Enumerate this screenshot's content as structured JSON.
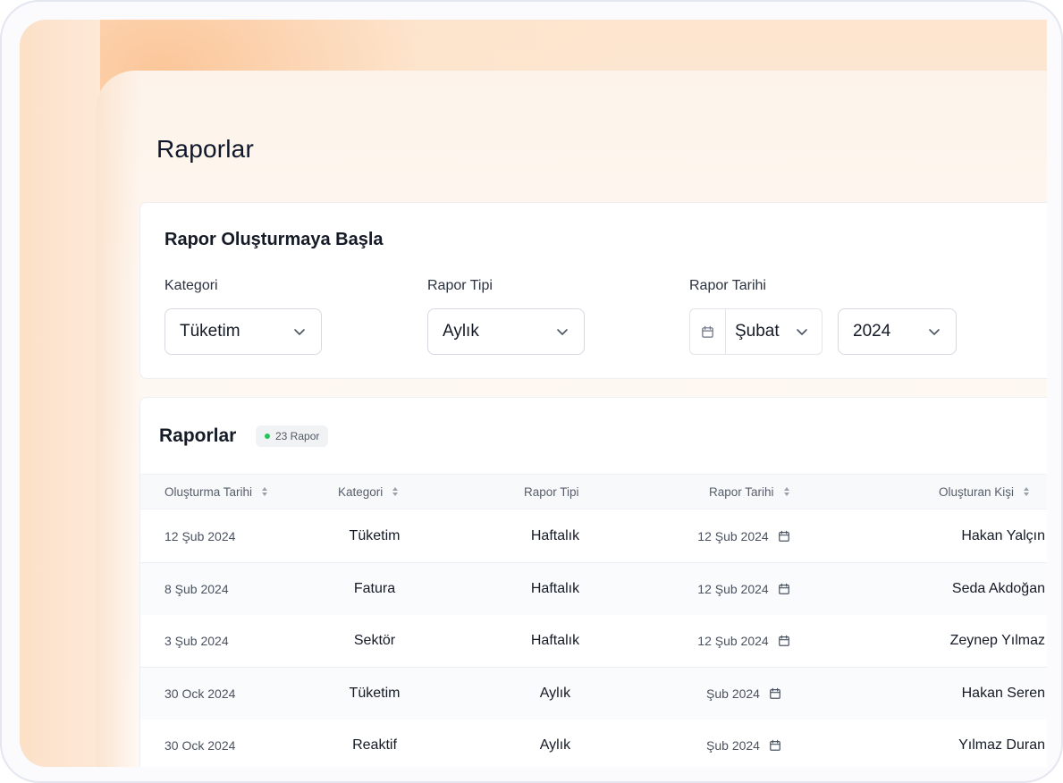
{
  "page": {
    "title": "Raporlar"
  },
  "filters": {
    "title": "Rapor Oluşturmaya Başla",
    "category": {
      "label": "Kategori",
      "value": "Tüketim"
    },
    "report_type": {
      "label": "Rapor Tipi",
      "value": "Aylık"
    },
    "report_date": {
      "label": "Rapor Tarihi",
      "month": "Şubat",
      "year": "2024"
    }
  },
  "table": {
    "title": "Raporlar",
    "badge": "23 Rapor",
    "columns": [
      "Oluşturma Tarihi",
      "Kategori",
      "Rapor Tipi",
      "Rapor Tarihi",
      "Oluşturan Kişi"
    ],
    "rows": [
      {
        "created": "12 Şub 2024",
        "category": "Tüketim",
        "type": "Haftalık",
        "report_date": "12 Şub 2024",
        "creator": "Hakan Yalçın"
      },
      {
        "created": "8 Şub 2024",
        "category": "Fatura",
        "type": "Haftalık",
        "report_date": "12 Şub 2024",
        "creator": "Seda Akdoğan"
      },
      {
        "created": "3 Şub 2024",
        "category": "Sektör",
        "type": "Haftalık",
        "report_date": "12 Şub 2024",
        "creator": "Zeynep Yılmaz"
      },
      {
        "created": "30 Ock 2024",
        "category": "Tüketim",
        "type": "Aylık",
        "report_date": "Şub 2024",
        "creator": "Hakan Seren"
      },
      {
        "created": "30 Ock 2024",
        "category": "Reaktif",
        "type": "Aylık",
        "report_date": "Şub 2024",
        "creator": "Yılmaz Duran"
      }
    ]
  },
  "colors": {
    "badge_dot": "#22c55e",
    "accent_bg": "#fde5cf"
  }
}
